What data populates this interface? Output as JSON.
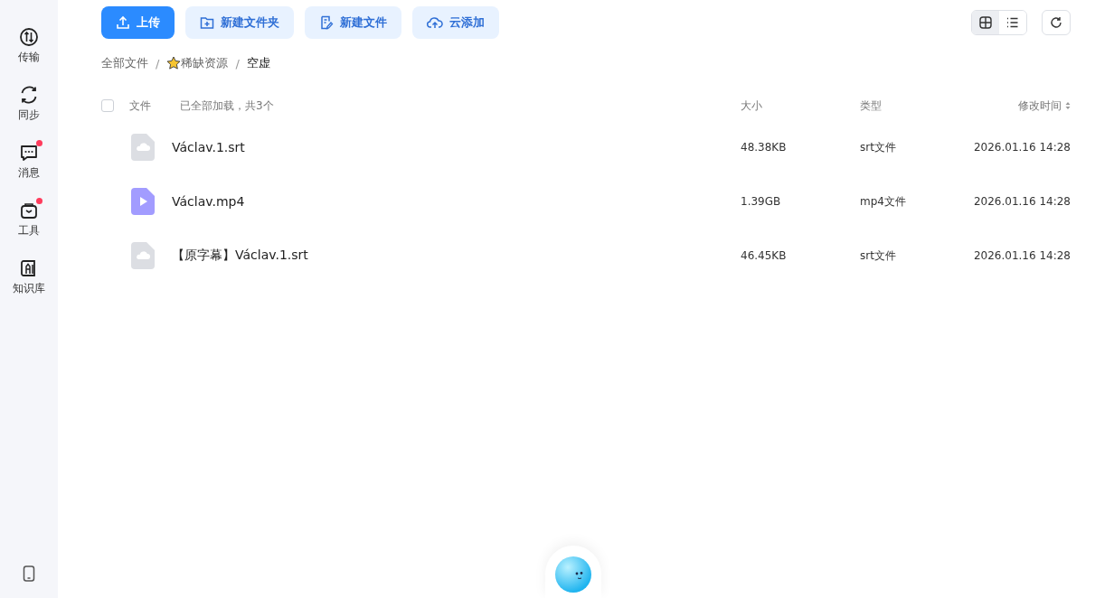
{
  "sidebar": {
    "items": [
      {
        "label": "传输",
        "badge": false
      },
      {
        "label": "同步",
        "badge": false
      },
      {
        "label": "消息",
        "badge": true
      },
      {
        "label": "工具",
        "badge": true
      },
      {
        "label": "知识库",
        "badge": false
      }
    ]
  },
  "toolbar": {
    "buttons": [
      {
        "label": "上传",
        "kind": "primary"
      },
      {
        "label": "新建文件夹",
        "kind": "secondary"
      },
      {
        "label": "新建文件",
        "kind": "secondary"
      },
      {
        "label": "云添加",
        "kind": "secondary"
      }
    ],
    "view_toggle": [
      {
        "selected": true
      },
      {
        "selected": false
      }
    ]
  },
  "breadcrumb": [
    {
      "label": "全部文件",
      "starred": false,
      "current": false
    },
    {
      "separator": "/",
      "label": "稀缺资源",
      "starred": true,
      "current": false
    },
    {
      "separator": "/",
      "label": "空虚",
      "starred": false,
      "current": true
    }
  ],
  "table": {
    "columns": [
      "文件",
      "大小",
      "类型",
      "修改时间"
    ],
    "load_status": "已全部加载，共3个",
    "all_checked": false,
    "rows": [
      {
        "name": "Václav.1.srt",
        "kind": "doc",
        "size": "48.38KB",
        "type": "srt文件",
        "modified": "2026.01.16 14:28"
      },
      {
        "name": "Václav.mp4",
        "kind": "video",
        "size": "1.39GB",
        "type": "mp4文件",
        "modified": "2026.01.16 14:28"
      },
      {
        "name": "【原字幕】Václav.1.srt",
        "kind": "doc",
        "size": "46.45KB",
        "type": "srt文件",
        "modified": "2026.01.16 14:28"
      }
    ]
  }
}
